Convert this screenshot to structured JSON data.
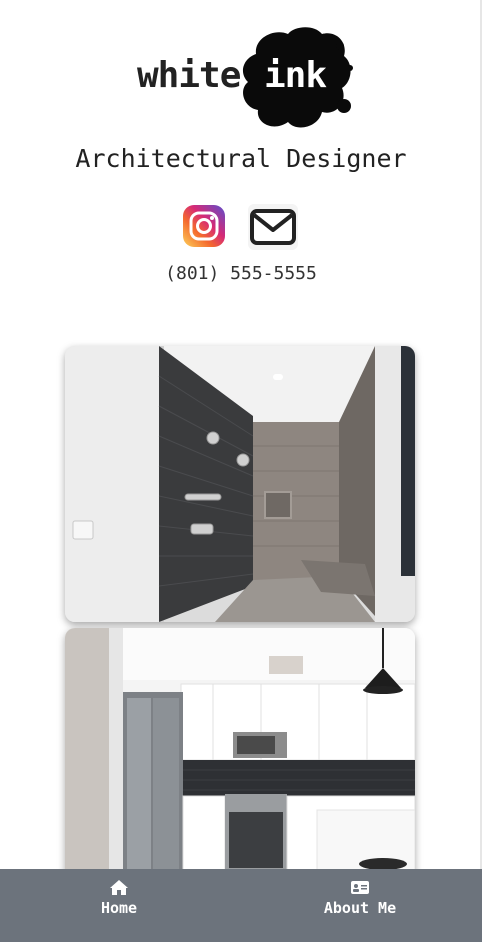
{
  "brand": {
    "logo_word_1": "white",
    "logo_word_2": "ink"
  },
  "header": {
    "subtitle": "Architectural Designer",
    "phone": "(801) 555-5555"
  },
  "social": {
    "instagram_icon": "instagram-icon",
    "mail_icon": "mail-icon"
  },
  "gallery": {
    "items": [
      {
        "subject": "walk-in shower"
      },
      {
        "subject": "kitchen"
      }
    ]
  },
  "nav": {
    "items": [
      {
        "label": "Home",
        "icon": "home-icon"
      },
      {
        "label": "About Me",
        "icon": "id-card-icon"
      }
    ],
    "background": "#6c737c"
  },
  "colors": {
    "ink": "#111111",
    "text": "#222222",
    "nav_bg": "#6c737c"
  }
}
